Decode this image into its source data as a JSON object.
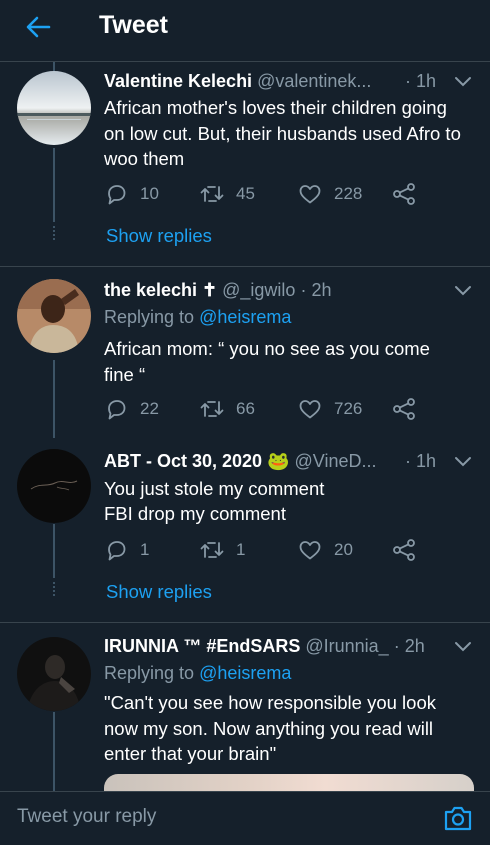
{
  "header": {
    "title": "Tweet"
  },
  "tweets": [
    {
      "name": "Valentine Kelechi",
      "handle": "@valentinek...",
      "time": "· 1h",
      "text": "African mother's loves their children going on low cut. But, their husbands used Afro to woo them",
      "replies": "10",
      "retweets": "45",
      "likes": "228",
      "show_replies": "Show replies"
    },
    {
      "name": "the kelechi ✝",
      "handle": "@_igwilo",
      "time": "· 2h",
      "replying_prefix": "Replying to",
      "replying_to": "@heisrema",
      "text": "African mom: “ you no see as you come fine “",
      "replies": "22",
      "retweets": "66",
      "likes": "726"
    },
    {
      "name": "ABT - Oct 30, 2020 🐸",
      "handle": "@VineD...",
      "time": "· 1h",
      "line1": "You just stole my comment",
      "line2": "FBI drop my comment",
      "replies": "1",
      "retweets": "1",
      "likes": "20",
      "show_replies": "Show replies"
    },
    {
      "name": "IRUNNIA ™ #EndSARS",
      "handle": "@Irunnia_",
      "time": "· 2h",
      "replying_prefix": "Replying to",
      "replying_to": "@heisrema",
      "text": "\"Can't you see how responsible you look now my son. Now anything you read will enter that your brain\""
    }
  ],
  "reply_bar": {
    "placeholder": "Tweet your reply"
  },
  "colors": {
    "accent": "#1da1f2",
    "background": "#15202b",
    "muted": "#8899a6",
    "divider": "#38444d"
  },
  "icons": [
    "back-arrow-icon",
    "chevron-down-icon",
    "reply-icon",
    "retweet-icon",
    "like-icon",
    "share-icon",
    "camera-icon"
  ]
}
